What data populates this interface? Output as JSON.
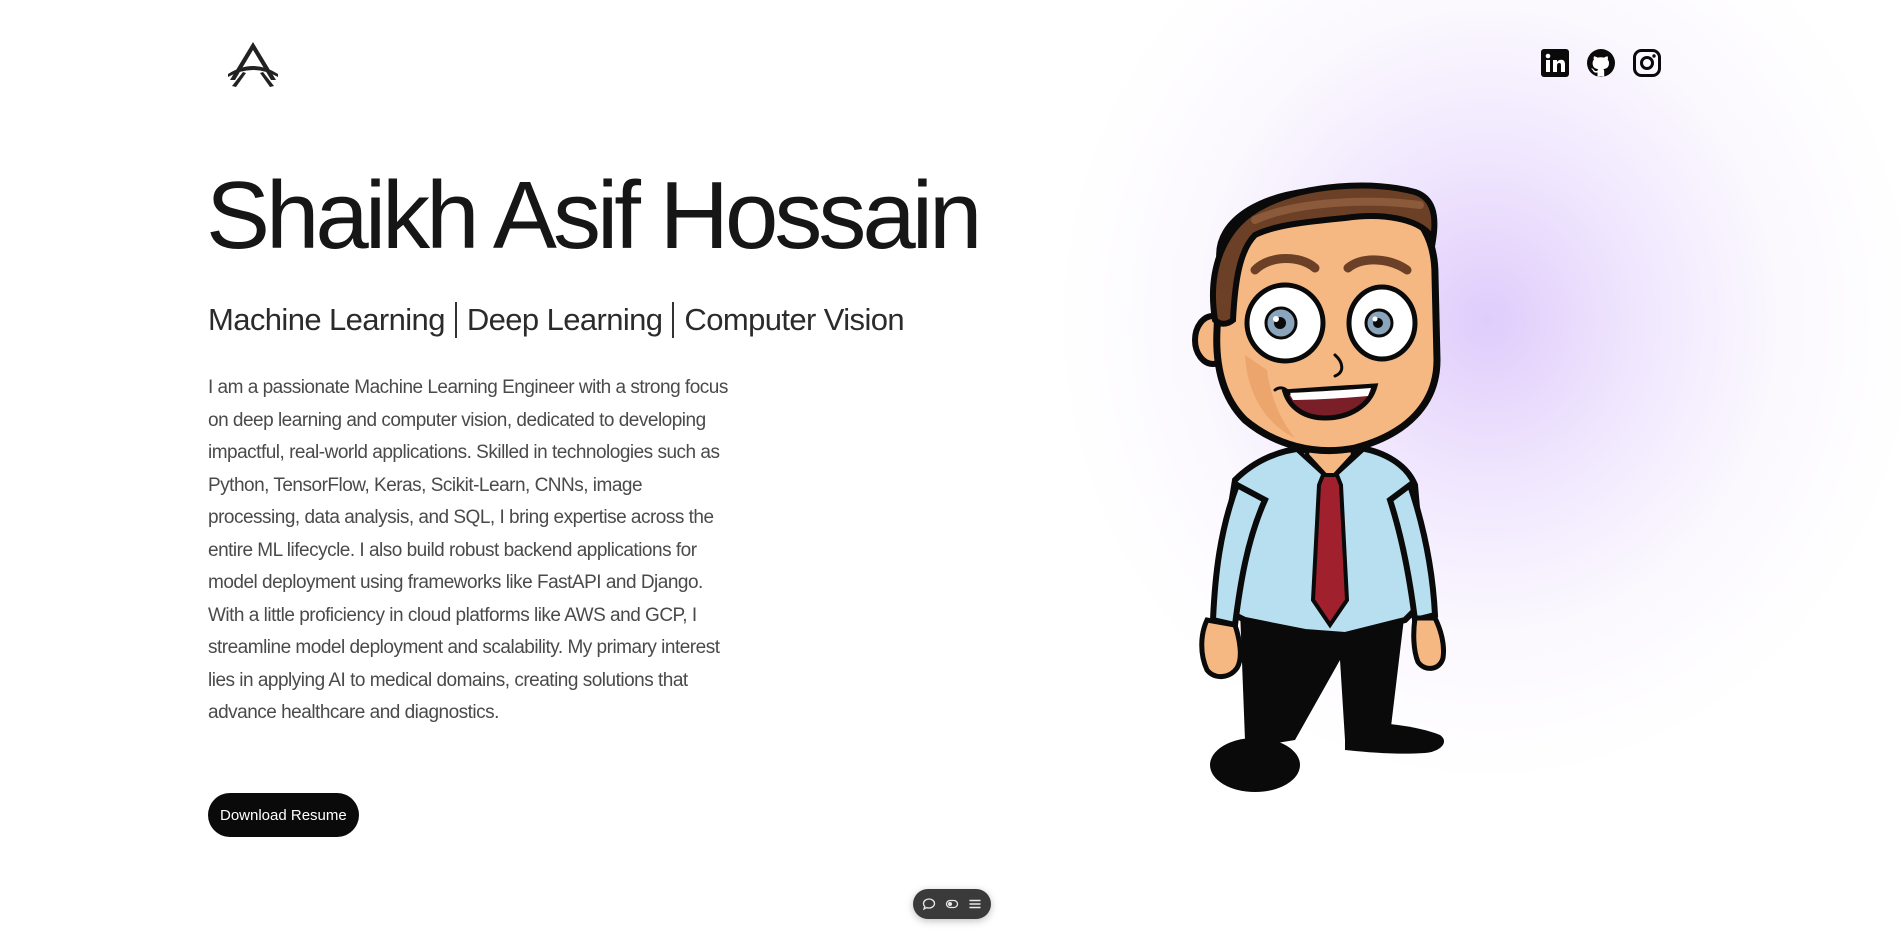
{
  "header": {
    "logo": "logo-icon",
    "socials": [
      {
        "name": "LinkedIn",
        "icon": "linkedin-icon"
      },
      {
        "name": "GitHub",
        "icon": "github-icon"
      },
      {
        "name": "Instagram",
        "icon": "instagram-icon"
      }
    ]
  },
  "hero": {
    "name": "Shaikh Asif Hossain",
    "tagline": [
      "Machine Learning",
      "Deep Learning",
      "Computer Vision"
    ],
    "bio": "I am a passionate Machine Learning Engineer with a strong focus on deep learning and computer vision, dedicated to developing impactful, real-world applications. Skilled in technologies such as Python, TensorFlow, Keras, Scikit-Learn, CNNs, image processing, data analysis, and SQL, I bring expertise across the entire ML lifecycle. I also build robust backend applications for model deployment using frameworks like FastAPI and Django. With a little proficiency in cloud platforms like AWS and GCP, I streamline model deployment and scalability. My primary interest lies in applying AI to medical domains, creating solutions that advance healthcare and diagnostics.",
    "resume_button": "Download Resume"
  },
  "toolbar": {
    "icons": [
      "comment-icon",
      "toggle-icon",
      "menu-icon"
    ]
  },
  "colors": {
    "accent_glow": "#d6befa",
    "button_bg": "#0a0a0a",
    "text": "#161616"
  }
}
